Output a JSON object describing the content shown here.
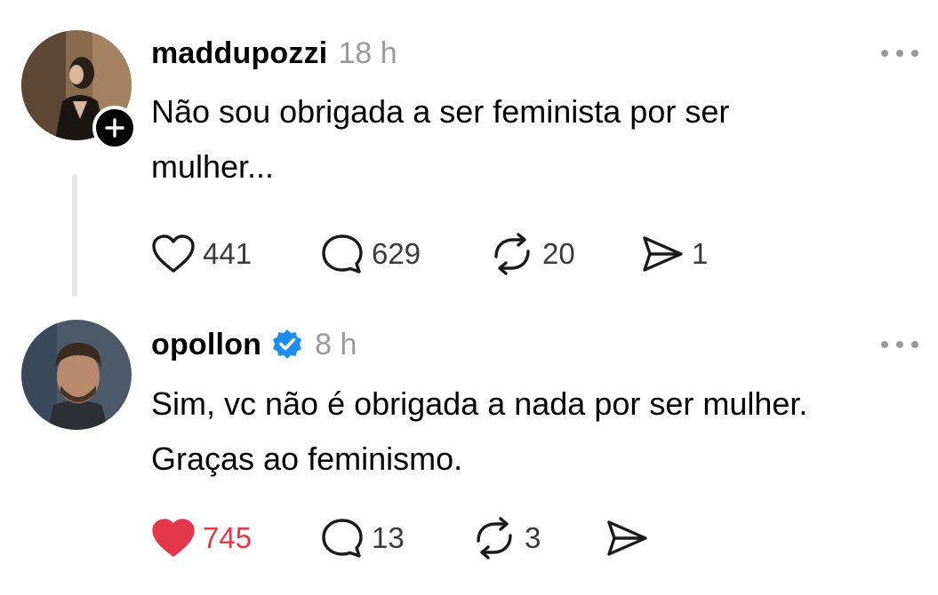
{
  "posts": [
    {
      "username": "maddupozzi",
      "time": "18 h",
      "lines": [
        "Não sou obrigada a ser feminista por ser",
        "mulher..."
      ],
      "stats": {
        "likes": "441",
        "replies": "629",
        "reposts": "20",
        "shares": "1"
      },
      "liked": false
    },
    {
      "username": "opollon",
      "verified": true,
      "time": "8 h",
      "lines": [
        "Sim, vc não é obrigada a nada por ser mulher.",
        "Graças ao feminismo."
      ],
      "stats": {
        "likes": "745",
        "replies": "13",
        "reposts": "3",
        "shares": ""
      },
      "liked": true
    }
  ],
  "colors": {
    "like_active": "#e5374a",
    "verified": "#1d8df0",
    "muted": "#9a9a9a"
  }
}
